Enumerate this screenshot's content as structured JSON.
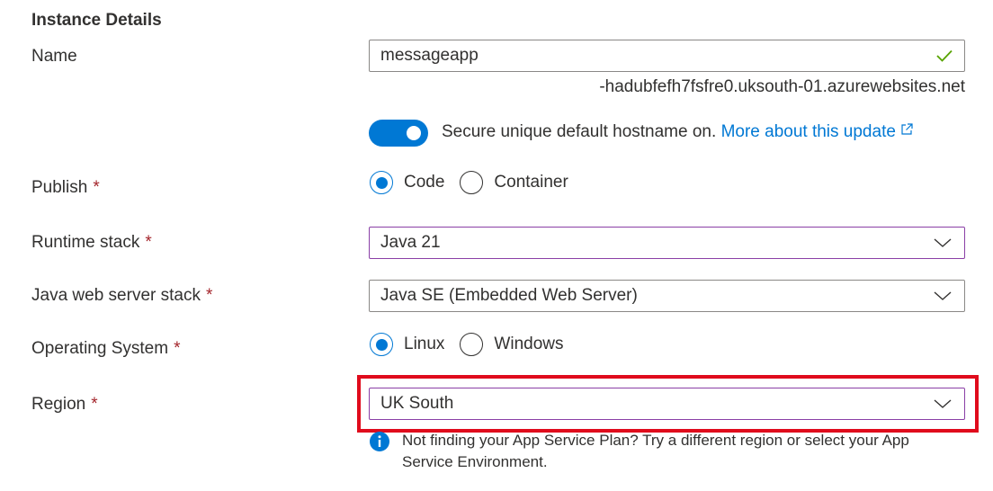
{
  "section": {
    "title": "Instance Details"
  },
  "name_field": {
    "label": "Name",
    "value": "messageapp",
    "suffix": "-hadubfefh7fsfre0.uksouth-01.azurewebsites.net",
    "valid_icon": "checkmark-icon"
  },
  "hostname_toggle": {
    "state": "on",
    "text": "Secure unique default hostname on.",
    "link_text": "More about this update",
    "link_icon": "external-link-icon"
  },
  "publish": {
    "label": "Publish",
    "required_mark": "*",
    "options": [
      {
        "label": "Code",
        "selected": true
      },
      {
        "label": "Container",
        "selected": false
      }
    ]
  },
  "runtime_stack": {
    "label": "Runtime stack",
    "required_mark": "*",
    "value": "Java 21"
  },
  "java_web_server_stack": {
    "label": "Java web server stack",
    "required_mark": "*",
    "value": "Java SE (Embedded Web Server)"
  },
  "operating_system": {
    "label": "Operating System",
    "required_mark": "*",
    "options": [
      {
        "label": "Linux",
        "selected": true
      },
      {
        "label": "Windows",
        "selected": false
      }
    ]
  },
  "region": {
    "label": "Region",
    "required_mark": "*",
    "value": "UK South",
    "info_icon": "info-icon",
    "info_text": "Not finding your App Service Plan? Try a different region or select your App Service Environment."
  },
  "colors": {
    "accent": "#0078d4",
    "required": "#a4262c",
    "highlight": "#e00b1c",
    "valid": "#57a300",
    "focus_border": "#8a3fa6"
  }
}
